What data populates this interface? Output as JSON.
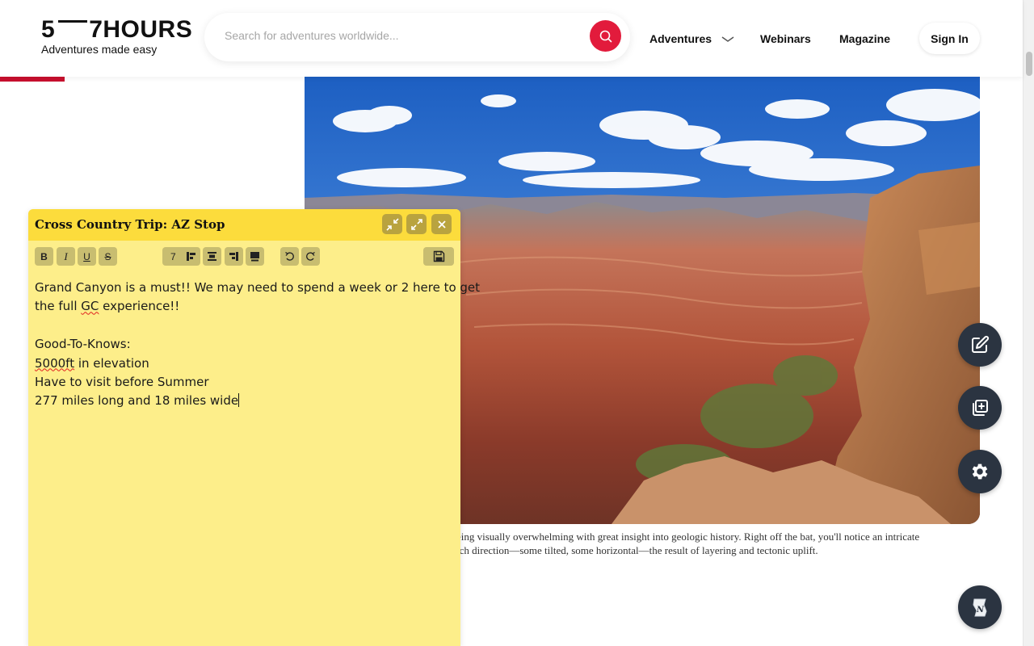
{
  "header": {
    "logo_text": "5 7HOURS",
    "logo_left": "5",
    "logo_right": "7HOURS",
    "tagline": "Adventures made easy",
    "search_placeholder": "Search for adventures worldwide...",
    "nav": [
      "Adventures",
      "Webinars",
      "Magazine"
    ],
    "signin_label": "Sign In",
    "accent_color": "#e21b3c"
  },
  "note": {
    "title": "Cross Country Trip: AZ Stop",
    "font_size_value": "7",
    "toolbar_icons": [
      "bold-icon",
      "italic-icon",
      "underline-icon",
      "strikethrough-icon",
      "align-left-icon",
      "align-center-icon",
      "align-right-icon",
      "align-justify-icon",
      "undo-icon",
      "redo-icon",
      "save-icon"
    ],
    "lines": {
      "l1": "Grand Canyon is a must!! We may need to spend a week or 2 here to get",
      "l2a": "the full ",
      "l2b": "GC",
      "l2c": " experience!!",
      "l3": "Good-To-Knows:",
      "l4a": "5000ft",
      "l4b": " in elevation",
      "l5": "Have to visit before Summer",
      "l6": "277 miles long and 18 miles wide"
    },
    "colors": {
      "body": "#fdee8a",
      "header": "#fcdc3c"
    }
  },
  "article": {
    "caption_line1": "eing visually overwhelming with great insight into geologic history. Right off the bat, you'll notice an intricate",
    "caption_line2": "ich direction—some tilted, some horizontal—the result of layering and tectonic uplift."
  },
  "floating_actions": [
    "edit-note-icon",
    "add-note-icon",
    "settings-icon",
    "notes-app-icon"
  ]
}
